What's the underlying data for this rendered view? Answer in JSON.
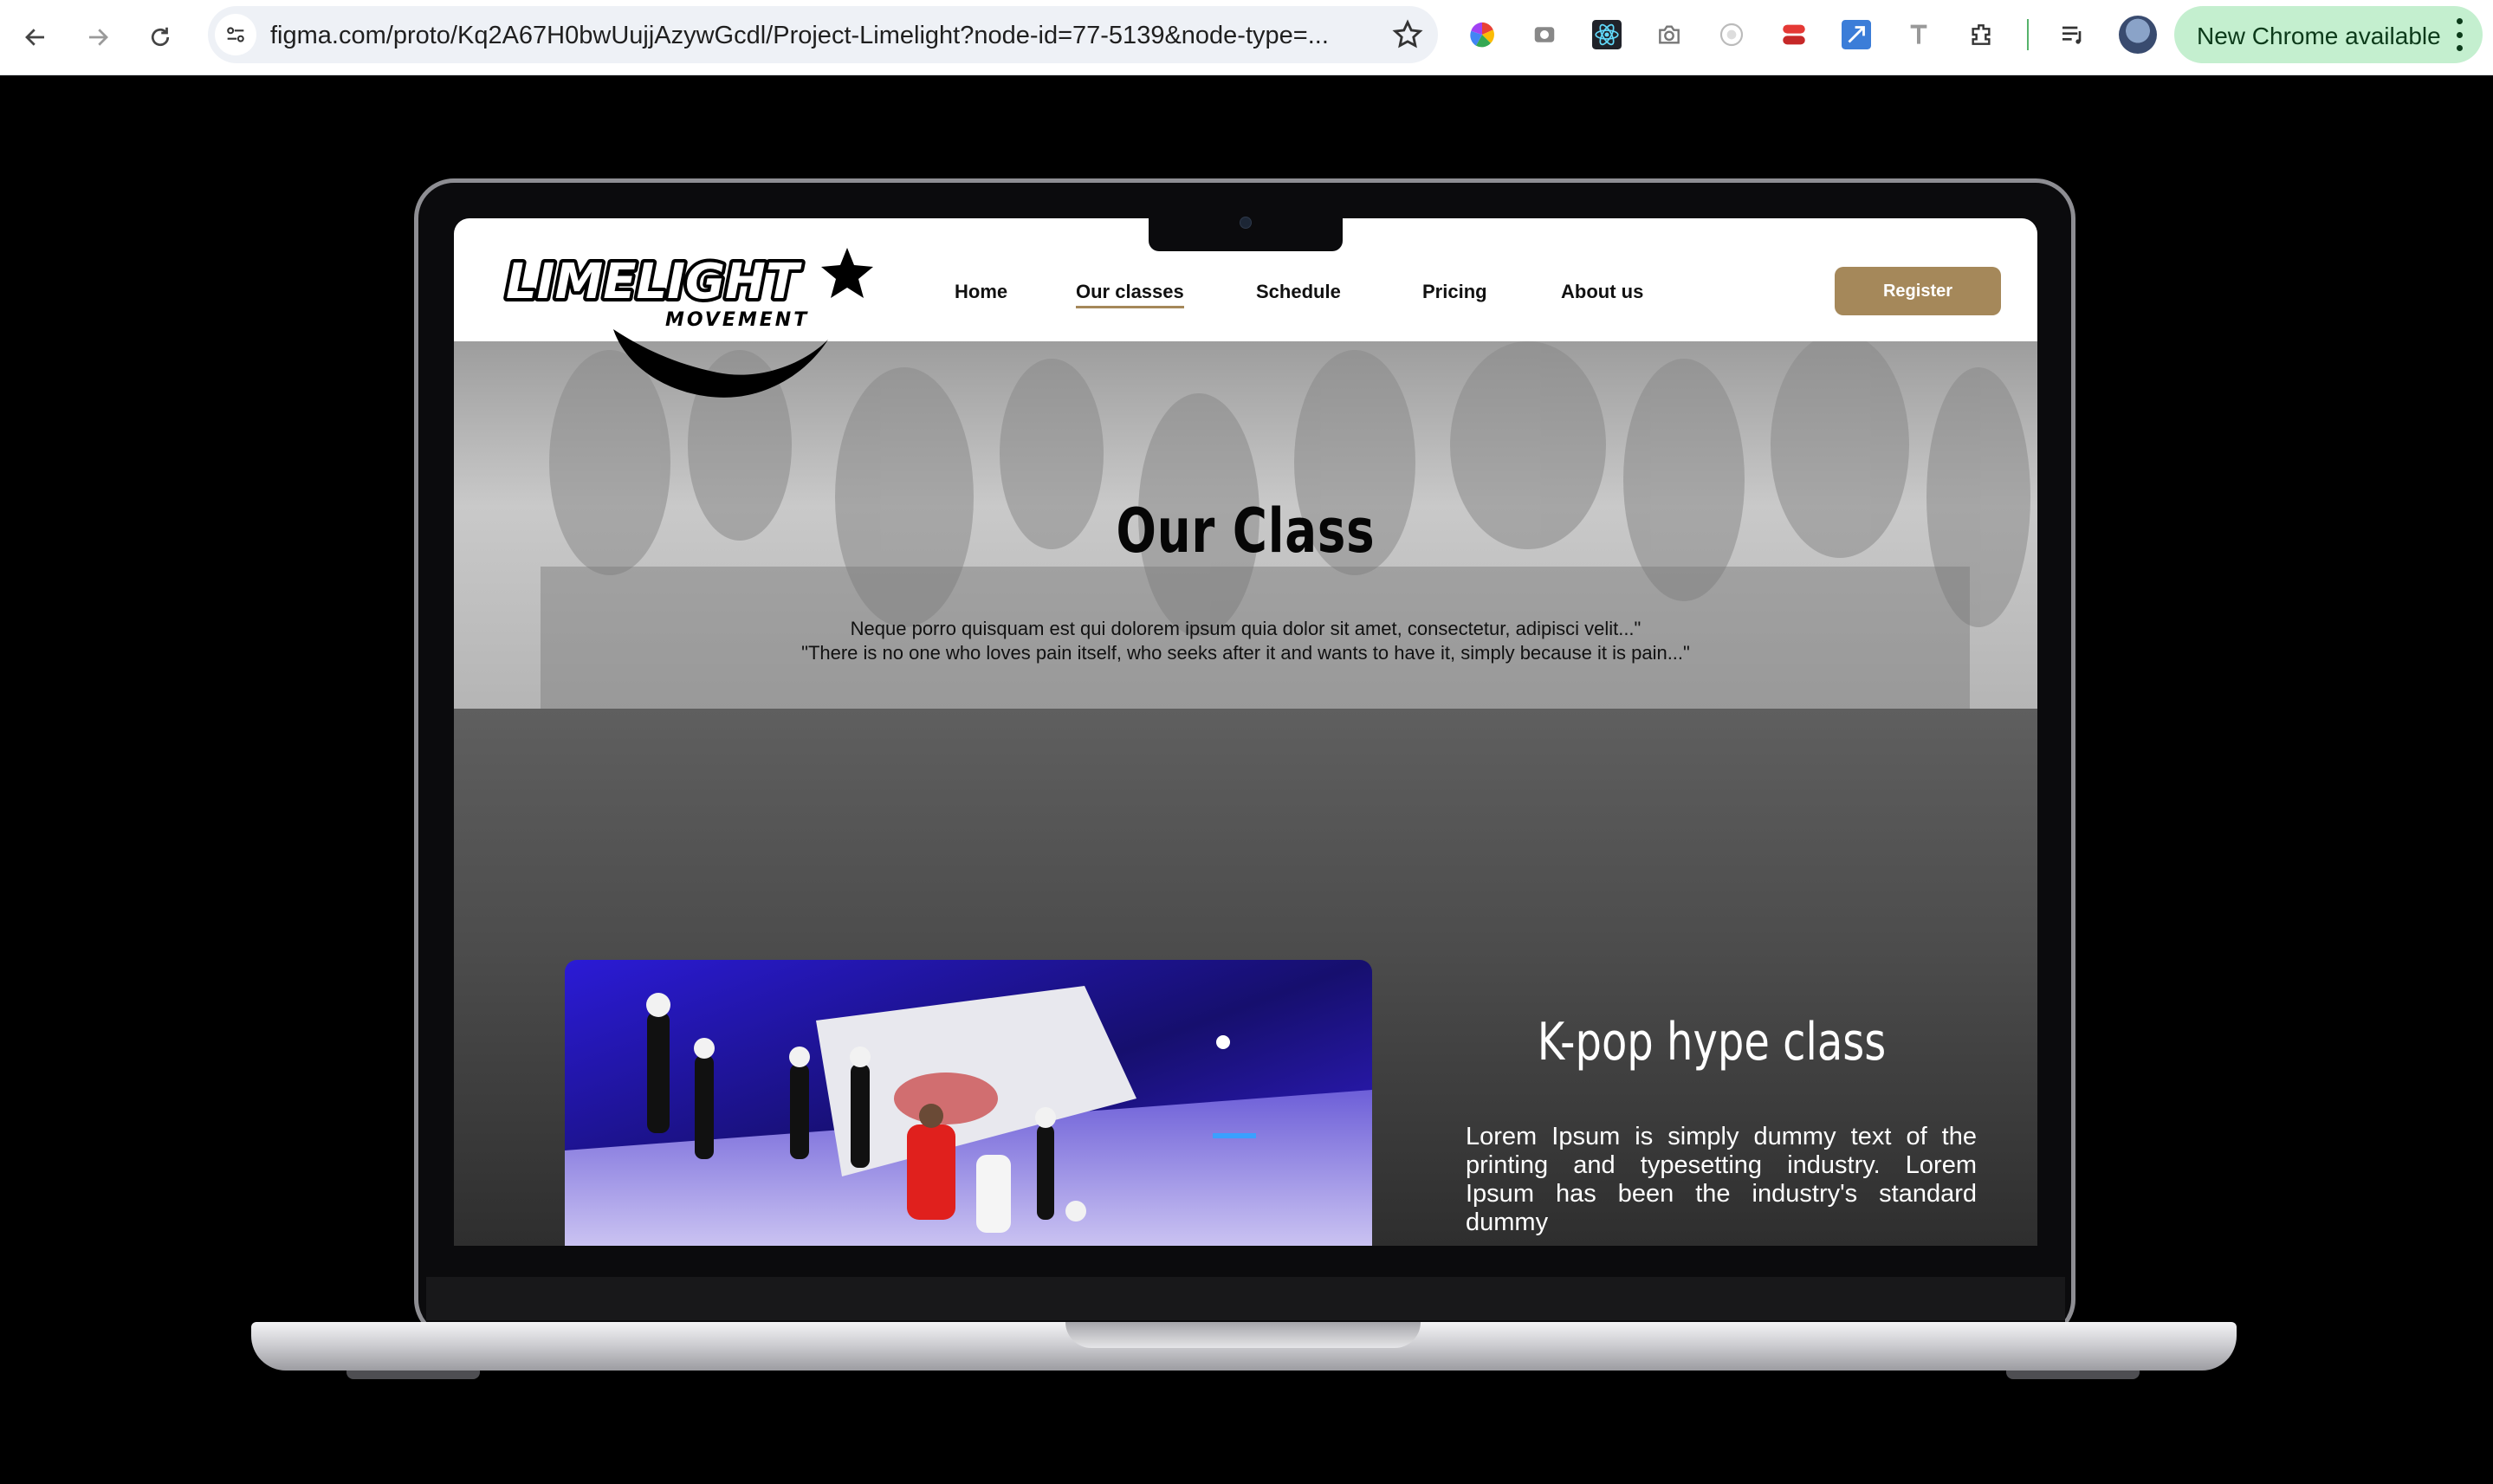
{
  "browser": {
    "url": "figma.com/proto/Kq2A67H0bwUujjAzywGcdl/Project-Limelight?node-id=77-5139&node-type=...",
    "update_label": "New Chrome available"
  },
  "colors": {
    "accent": "#a5885a",
    "chrome_update_pill": "#c4efcf",
    "page_background": "#000000"
  },
  "site": {
    "logo": {
      "wordmark": "LIMELIGHT",
      "tagline": "MOVEMENT"
    },
    "nav": [
      {
        "label": "Home",
        "active": false
      },
      {
        "label": "Our classes",
        "active": true
      },
      {
        "label": "Schedule",
        "active": false
      },
      {
        "label": "Pricing",
        "active": false
      },
      {
        "label": "About us",
        "active": false
      }
    ],
    "register_label": "Register",
    "hero": {
      "title": "Our Class",
      "line1": "Neque porro quisquam est qui dolorem ipsum quia dolor sit amet, consectetur, adipisci velit...\"",
      "line2": "\"There is no one who loves pain itself, who seeks after it and wants to have it, simply because it is pain...\""
    },
    "class_card": {
      "title": "K-pop hype class",
      "description": "Lorem Ipsum is simply dummy text of the printing and typesetting industry. Lorem Ipsum has been the industry's standard dummy"
    }
  }
}
